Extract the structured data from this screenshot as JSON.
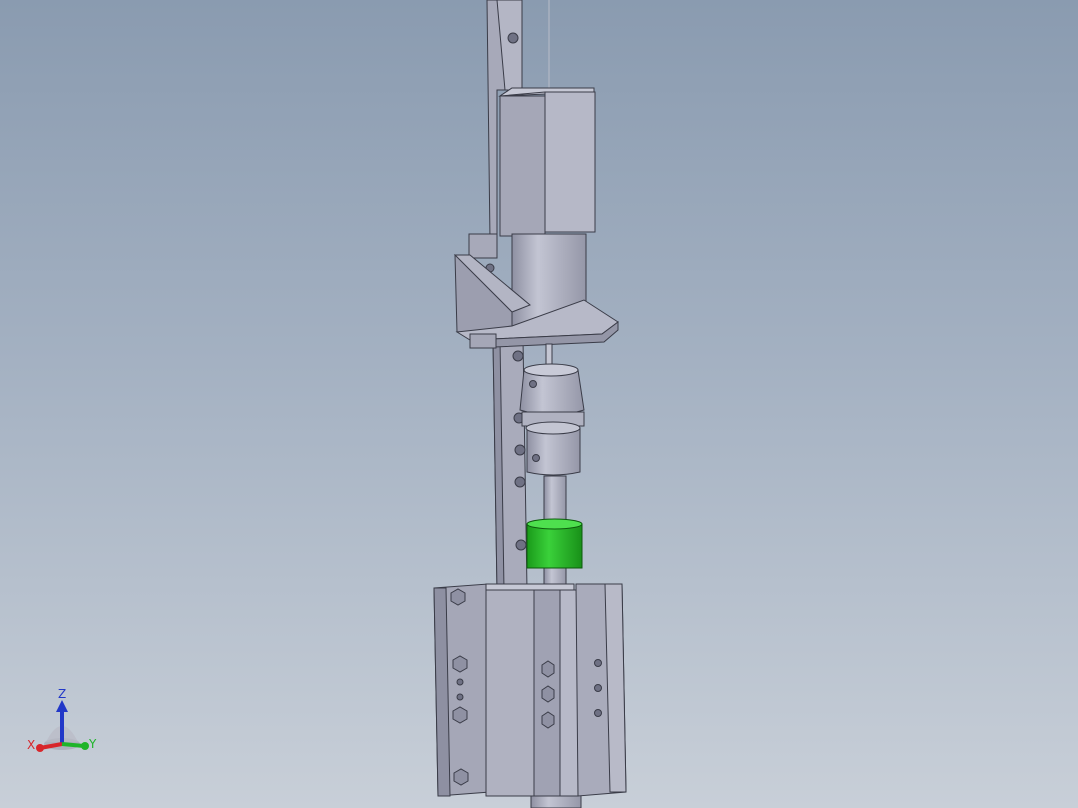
{
  "viewport": {
    "background_top": "#8a9bb0",
    "background_bottom": "#c8cfd8",
    "part_color": "#a9abbb",
    "highlight_color": "#22b822"
  },
  "model": {
    "components": [
      "mounting-rail",
      "stepper-motor",
      "motor-mount-bracket",
      "flexible-coupling",
      "lead-screw",
      "lead-screw-nut",
      "linear-slide-block"
    ]
  },
  "triad": {
    "z_label": "Z",
    "x_label": "X",
    "y_label": "Y",
    "x_color": "#d8262b",
    "y_color": "#1fb42a",
    "z_color": "#2238c8"
  }
}
